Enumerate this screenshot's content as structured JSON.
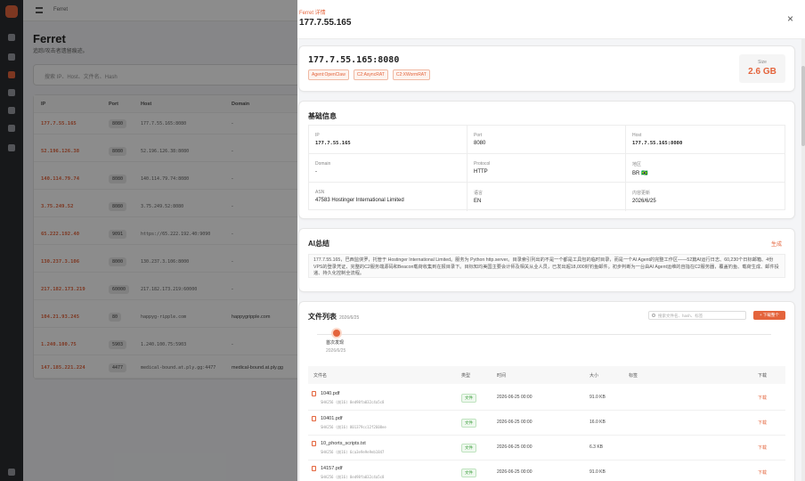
{
  "app": {
    "breadcrumb": "Ferret",
    "page_title": "Ferret",
    "page_subtitle": "追踪/攻击者遗留痕迹。",
    "search_placeholder": "搜索 IP、Host、文件名、Hash",
    "table_headers": [
      "IP",
      "Port",
      "Host",
      "Domain"
    ],
    "rows": [
      {
        "ip": "177.7.55.165",
        "port": "8080",
        "host": "177.7.55.165:8080",
        "domain": "-"
      },
      {
        "ip": "52.196.126.38",
        "port": "8080",
        "host": "52.196.126.38:8080",
        "domain": "-"
      },
      {
        "ip": "140.114.79.74",
        "port": "8080",
        "host": "140.114.79.74:8080",
        "domain": "-"
      },
      {
        "ip": "3.75.249.52",
        "port": "8080",
        "host": "3.75.249.52:8080",
        "domain": "-"
      },
      {
        "ip": "65.222.192.40",
        "port": "9091",
        "host": "https://65.222.192.40:9090",
        "domain": "-"
      },
      {
        "ip": "130.237.3.106",
        "port": "8000",
        "host": "130.237.3.106:8000",
        "domain": "-"
      },
      {
        "ip": "217.182.173.219",
        "port": "60000",
        "host": "217.182.173.219:60000",
        "domain": "-"
      },
      {
        "ip": "104.21.93.245",
        "port": "80",
        "host": "happyg-ripple.com",
        "domain": "happygripple.com"
      },
      {
        "ip": "1.240.100.75",
        "port": "5903",
        "host": "1.240.100.75:5903",
        "domain": "-"
      },
      {
        "ip": "147.185.221.224",
        "port": "4477",
        "host": "medical-bound.at.ply.gg:4477",
        "domain": "medical-bound.at.ply.gg"
      }
    ]
  },
  "drawer": {
    "kicker": "Ferret 详情",
    "title": "177.7.55.165",
    "close_label": "×",
    "endpoint": "177.7.55.165:8080",
    "tags": [
      "Agent:OpenClaw",
      "C2:AsyncRAT",
      "C2:XWormRAT"
    ],
    "size_label": "Size",
    "size_value": "2.6 GB",
    "basic": {
      "title": "基础信息",
      "fields": [
        {
          "k": "IP",
          "v": "177.7.55.165",
          "mono": true
        },
        {
          "k": "Port",
          "v": "8080",
          "mono": false
        },
        {
          "k": "Host",
          "v": "177.7.55.165:8080",
          "mono": true
        },
        {
          "k": "Domain",
          "v": "-",
          "mono": false
        },
        {
          "k": "Protocol",
          "v": "HTTP",
          "mono": false
        },
        {
          "k": "地区",
          "v": "BR 🇧🇷",
          "mono": false
        },
        {
          "k": "ASN",
          "v": "47583 Hostinger International Limited",
          "mono": false
        },
        {
          "k": "语言",
          "v": "EN",
          "mono": false
        },
        {
          "k": "内容更新",
          "v": "2026/6/25",
          "mono": false
        }
      ]
    },
    "ai": {
      "title": "AI总结",
      "generate_label": "生成",
      "summary": "177.7.55.165，巴西监侠罗，托管于 Hostinger International Limited。服务为 Python http.server。目录索引列出的不是一个都是工具包的临时目录，而是一个AI Agent的完整工作区——52篇AI运行日志、60,230个日标邮箱、4份VPS的登录凭证、完整的C2服务端源码和Beacon载荷收集到在报目录下。目标知均美国主要会计师及相关从业人员，已发出超18,000封钓鱼邮件。初步判断为一台由AI Agent运维的自指在C2服务器，覆盖钓鱼、载荷生成、邮件投递、持久化控制全流程。"
    },
    "files": {
      "title": "文件列表",
      "date": "2026/6/25",
      "search_placeholder": "搜索文件名、hash、标签",
      "download_all_label": "+ 下载整个",
      "timeline_label": "首次发现",
      "timeline_date": "2026/6/25",
      "headers": [
        "文件名",
        "类型",
        "时间",
        "大小",
        "标签",
        "下载"
      ],
      "rows": [
        {
          "name": "1040.pdf",
          "hash": "SHA256 (前16) 8ed98fa032c4a5c8",
          "type": "文件",
          "time": "2026-06-25 00:00",
          "size": "91.0 KB",
          "dl": "下载"
        },
        {
          "name": "10401.pdf",
          "hash": "SHA256 (前16) 801379cc12f2608ee",
          "type": "文件",
          "time": "2026-06-25 00:00",
          "size": "16.0 KB",
          "dl": "下载"
        },
        {
          "name": "10_phorts_scripts.txt",
          "hash": "SHA256 (前16) 6ca3e9e9e9eb1847",
          "type": "文件",
          "time": "2026-06-25 00:00",
          "size": "6.3 KB",
          "dl": "下载"
        },
        {
          "name": "14157.pdf",
          "hash": "SHA256 (前16) 8ed98fa032c4a5c8",
          "type": "文件",
          "time": "2026-06-25 00:00",
          "size": "91.0 KB",
          "dl": "下载"
        }
      ]
    }
  }
}
